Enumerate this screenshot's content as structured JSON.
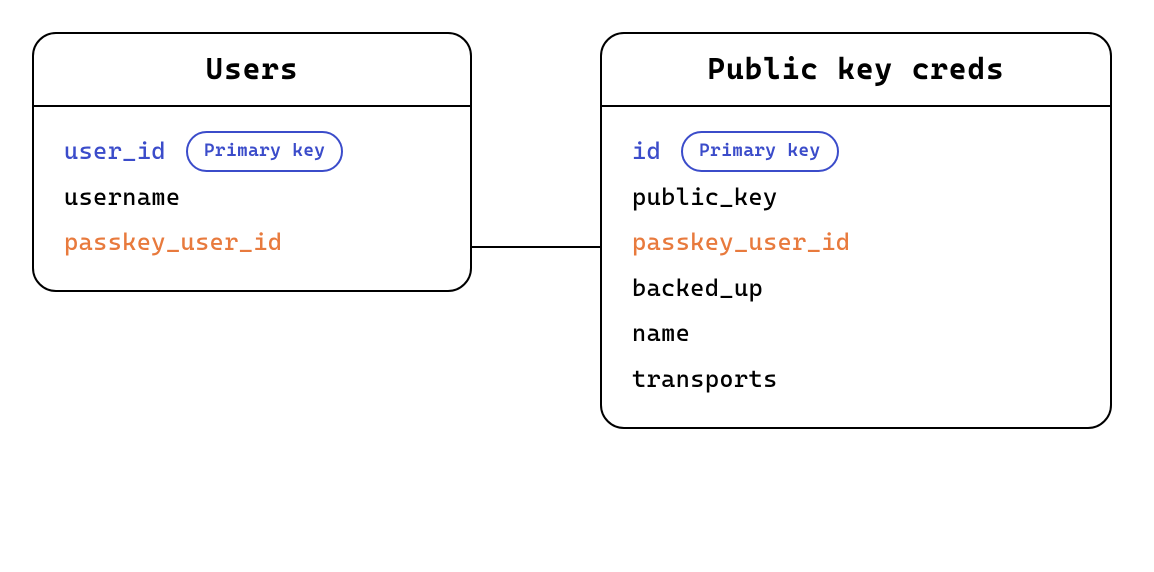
{
  "entities": {
    "users": {
      "title": "Users",
      "fields": [
        {
          "name": "user_id",
          "color": "blue",
          "pk_label": "Primary key"
        },
        {
          "name": "username",
          "color": "black"
        },
        {
          "name": "passkey_user_id",
          "color": "orange"
        }
      ]
    },
    "creds": {
      "title": "Public key creds",
      "fields": [
        {
          "name": "id",
          "color": "blue",
          "pk_label": "Primary key"
        },
        {
          "name": "public_key",
          "color": "black"
        },
        {
          "name": "passkey_user_id",
          "color": "orange"
        },
        {
          "name": "backed_up",
          "color": "black"
        },
        {
          "name": "name",
          "color": "black"
        },
        {
          "name": "transports",
          "color": "black"
        }
      ]
    }
  },
  "relationship": {
    "from": "users.passkey_user_id",
    "to": "creds.passkey_user_id"
  }
}
